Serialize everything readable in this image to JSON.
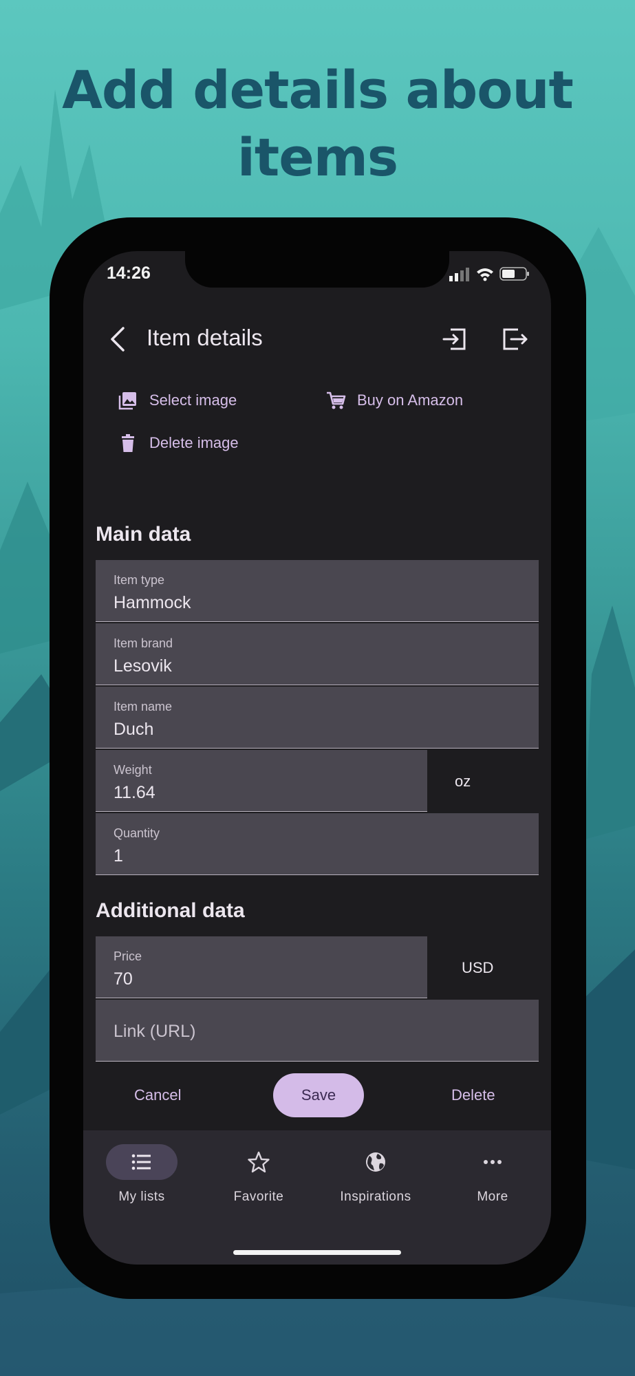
{
  "headline": "Add details about items",
  "status_bar": {
    "time": "14:26"
  },
  "app_bar": {
    "title": "Item details"
  },
  "image_actions": {
    "select": "Select image",
    "buy": "Buy on Amazon",
    "delete": "Delete image"
  },
  "main_data": {
    "title": "Main data",
    "item_type": {
      "label": "Item type",
      "value": "Hammock"
    },
    "item_brand": {
      "label": "Item brand",
      "value": "Lesovik"
    },
    "item_name": {
      "label": "Item name",
      "value": "Duch"
    },
    "weight": {
      "label": "Weight",
      "value": "11.64",
      "unit": "oz"
    },
    "quantity": {
      "label": "Quantity",
      "value": "1"
    }
  },
  "additional_data": {
    "title": "Additional data",
    "price": {
      "label": "Price",
      "value": "70",
      "currency": "USD"
    },
    "link": {
      "placeholder": "Link (URL)"
    }
  },
  "buttons": {
    "cancel": "Cancel",
    "save": "Save",
    "delete": "Delete"
  },
  "nav": [
    {
      "label": "My lists",
      "icon": "list-icon",
      "active": true
    },
    {
      "label": "Favorite",
      "icon": "star-icon",
      "active": false
    },
    {
      "label": "Inspirations",
      "icon": "globe-icon",
      "active": false
    },
    {
      "label": "More",
      "icon": "more-icon",
      "active": false
    }
  ],
  "colors": {
    "accent": "#d4bbe8",
    "accent_text": "#d6bee9",
    "headline": "#1a5569",
    "field_bg": "#4a4750",
    "screen_bg": "#1d1c1f"
  }
}
